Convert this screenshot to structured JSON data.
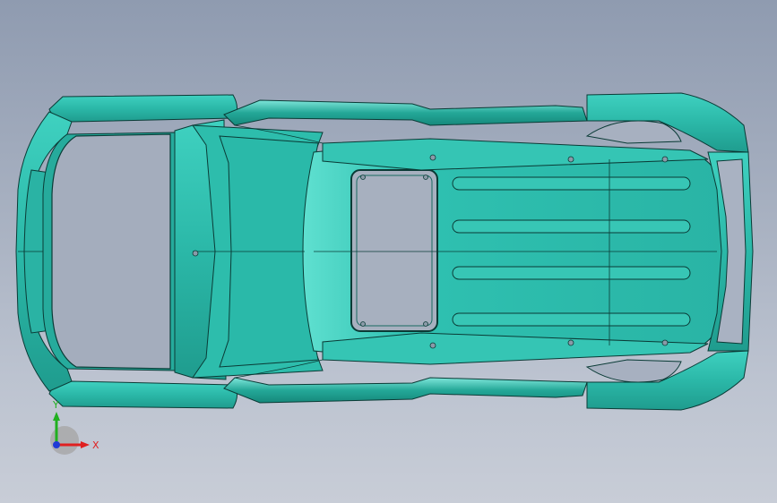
{
  "viewport": {
    "background_top": "#8f9bb0",
    "background_bottom": "#c8cdd7"
  },
  "model": {
    "body_color": "#2bb8a8",
    "edge_color": "#0a3b36",
    "highlight_color": "#8fe8dc",
    "shadow_color": "#178a7c"
  },
  "triad": {
    "x_label": "X",
    "y_label": "Y",
    "x_color": "#e02020",
    "y_color": "#20b020",
    "z_color": "#1f3bd6"
  }
}
